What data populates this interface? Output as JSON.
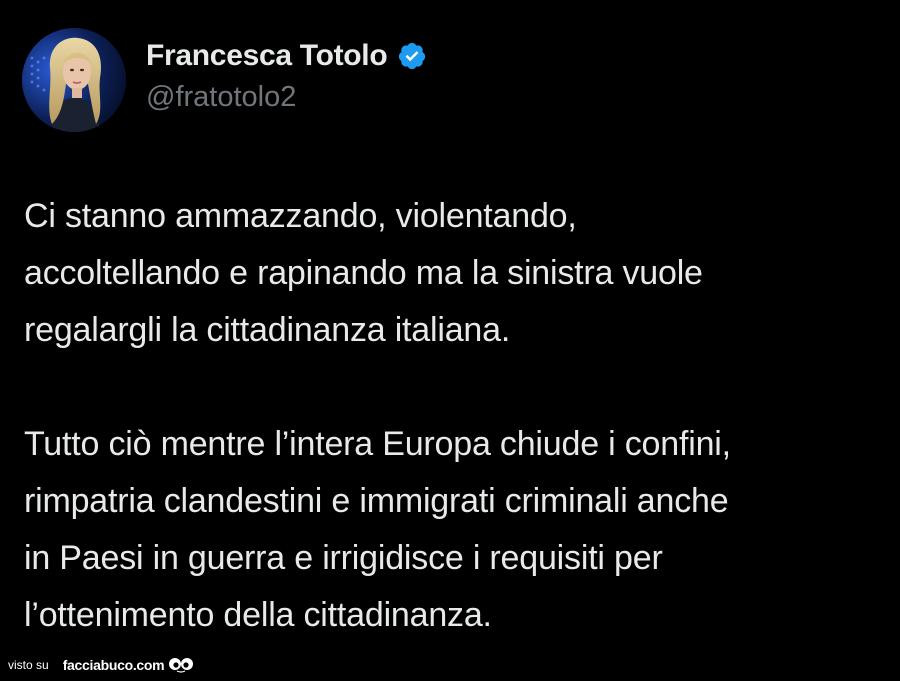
{
  "tweet": {
    "author": {
      "display_name": "Francesca Totolo",
      "handle": "@fratotolo2",
      "verified": true,
      "verified_badge_color": "#1d9bf0"
    },
    "paragraphs": [
      {
        "lines": [
          "Ci stanno ammazzando, violentando,",
          "accoltellando e rapinando ma la sinistra vuole",
          "regalargli la cittadinanza italiana."
        ]
      },
      {
        "lines": [
          "Tutto ciò mentre l’intera Europa chiude i confini,",
          "rimpatria clandestini e immigrati criminali anche",
          "in Paesi in guerra e irrigidisce i requisiti per",
          "l’ottenimento della cittadinanza."
        ]
      }
    ]
  },
  "watermark": {
    "prefix": "visto su",
    "brand": "facciabuco.com"
  },
  "colors": {
    "background": "#000000",
    "text": "#e7e9ea",
    "secondary_text": "#71767b"
  }
}
